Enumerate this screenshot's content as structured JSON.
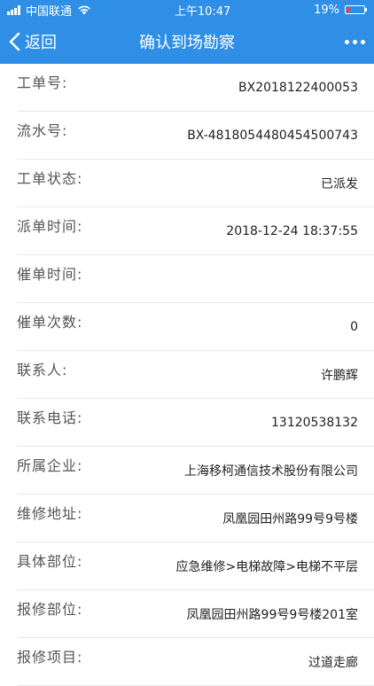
{
  "status_bar": {
    "carrier": "中国联通",
    "time": "上午10:47",
    "battery": "19%",
    "battery_level": 0.19
  },
  "nav": {
    "back_label": "返回",
    "title": "确认到场勘察",
    "more_icon": "ellipsis-icon"
  },
  "fields": [
    {
      "label": "工单号:",
      "value": "BX2018122400053"
    },
    {
      "label": "流水号:",
      "value": "BX-4818054480454500743"
    },
    {
      "label": "工单状态:",
      "value": "已派发"
    },
    {
      "label": "派单时间:",
      "value": "2018-12-24 18:37:55"
    },
    {
      "label": "催单时间:",
      "value": ""
    },
    {
      "label": "催单次数:",
      "value": "0"
    },
    {
      "label": "联系人:",
      "value": "许鹏辉"
    },
    {
      "label": "联系电话:",
      "value": "13120538132"
    },
    {
      "label": "所属企业:",
      "value": "上海移柯通信技术股份有限公司"
    },
    {
      "label": "维修地址:",
      "value": "凤凰园田州路99号9号楼"
    },
    {
      "label": "具体部位:",
      "value": "应急维修>电梯故障>电梯不平层"
    },
    {
      "label": "报修部位:",
      "value": "凤凰园田州路99号9号楼201室"
    },
    {
      "label": "报修项目:",
      "value": "过道走廊"
    }
  ]
}
